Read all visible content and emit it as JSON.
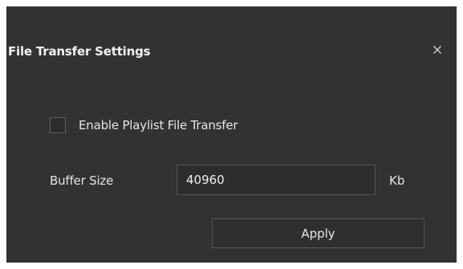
{
  "dialog": {
    "title": "File Transfer Settings",
    "close_icon": "close-icon"
  },
  "playlist_transfer": {
    "label": "Enable Playlist File Transfer",
    "checked": false
  },
  "buffer": {
    "label": "Buffer Size",
    "value": "40960",
    "unit": "Kb"
  },
  "actions": {
    "apply_label": "Apply"
  },
  "colors": {
    "background": "#323232",
    "text": "#e6e6e6",
    "border": "#555555"
  }
}
